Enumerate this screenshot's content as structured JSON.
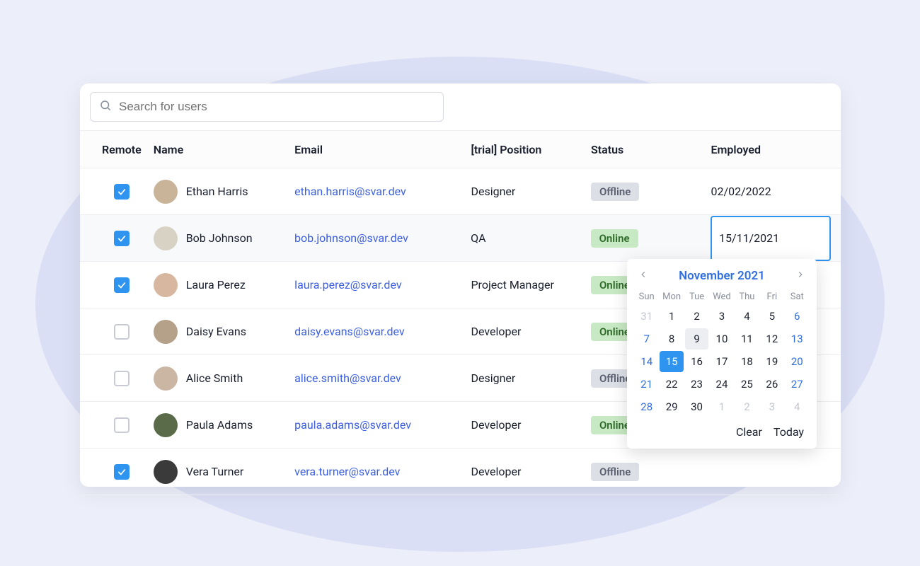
{
  "search": {
    "placeholder": "Search for users"
  },
  "columns": {
    "remote": "Remote",
    "name": "Name",
    "email": "Email",
    "position": "[trial] Position",
    "status": "Status",
    "employed": "Employed"
  },
  "status_labels": {
    "online": "Online",
    "offline": "Offline"
  },
  "rows": [
    {
      "remote": true,
      "name": "Ethan Harris",
      "email": "ethan.harris@svar.dev",
      "position": "Designer",
      "status": "offline",
      "employed": "02/02/2022",
      "avatar_bg": "#c9b49a"
    },
    {
      "remote": true,
      "name": "Bob Johnson",
      "email": "bob.johnson@svar.dev",
      "position": "QA",
      "status": "online",
      "employed": "15/11/2021",
      "avatar_bg": "#d8d2c4",
      "editing": true
    },
    {
      "remote": true,
      "name": "Laura Perez",
      "email": "laura.perez@svar.dev",
      "position": "Project Manager",
      "status": "online",
      "employed": "",
      "avatar_bg": "#d7b7a0"
    },
    {
      "remote": false,
      "name": "Daisy Evans",
      "email": "daisy.evans@svar.dev",
      "position": "Developer",
      "status": "online",
      "employed": "",
      "avatar_bg": "#b5a08a"
    },
    {
      "remote": false,
      "name": "Alice Smith",
      "email": "alice.smith@svar.dev",
      "position": "Designer",
      "status": "offline",
      "employed": "",
      "avatar_bg": "#cbb6a3"
    },
    {
      "remote": false,
      "name": "Paula Adams",
      "email": "paula.adams@svar.dev",
      "position": "Developer",
      "status": "online",
      "employed": "",
      "avatar_bg": "#5a6b4a"
    },
    {
      "remote": true,
      "name": "Vera Turner",
      "email": "vera.turner@svar.dev",
      "position": "Developer",
      "status": "offline",
      "employed": "",
      "avatar_bg": "#3a3a3a"
    }
  ],
  "datepicker": {
    "title": "November 2021",
    "dows": [
      "Sun",
      "Mon",
      "Tue",
      "Wed",
      "Thu",
      "Fri",
      "Sat"
    ],
    "weeks": [
      [
        {
          "n": 31,
          "muted": true,
          "weekend": true
        },
        {
          "n": 1
        },
        {
          "n": 2
        },
        {
          "n": 3
        },
        {
          "n": 4
        },
        {
          "n": 5
        },
        {
          "n": 6,
          "weekend": true
        }
      ],
      [
        {
          "n": 7,
          "weekend": true
        },
        {
          "n": 8
        },
        {
          "n": 9,
          "hover": true
        },
        {
          "n": 10
        },
        {
          "n": 11
        },
        {
          "n": 12
        },
        {
          "n": 13,
          "weekend": true
        }
      ],
      [
        {
          "n": 14,
          "weekend": true
        },
        {
          "n": 15,
          "selected": true
        },
        {
          "n": 16
        },
        {
          "n": 17
        },
        {
          "n": 18
        },
        {
          "n": 19
        },
        {
          "n": 20,
          "weekend": true
        }
      ],
      [
        {
          "n": 21,
          "weekend": true
        },
        {
          "n": 22
        },
        {
          "n": 23
        },
        {
          "n": 24
        },
        {
          "n": 25
        },
        {
          "n": 26
        },
        {
          "n": 27,
          "weekend": true
        }
      ],
      [
        {
          "n": 28,
          "weekend": true
        },
        {
          "n": 29
        },
        {
          "n": 30
        },
        {
          "n": 1,
          "muted": true
        },
        {
          "n": 2,
          "muted": true
        },
        {
          "n": 3,
          "muted": true
        },
        {
          "n": 4,
          "muted": true
        }
      ]
    ],
    "clear": "Clear",
    "today": "Today"
  }
}
